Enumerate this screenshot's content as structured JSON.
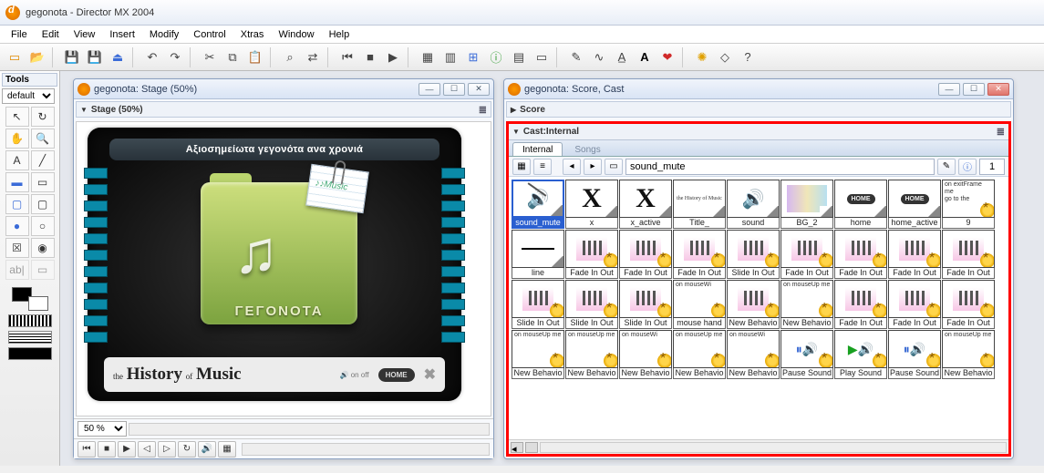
{
  "app": {
    "title": "gegonota - Director MX 2004"
  },
  "menu": [
    "File",
    "Edit",
    "View",
    "Insert",
    "Modify",
    "Control",
    "Xtras",
    "Window",
    "Help"
  ],
  "tools": {
    "header": "Tools",
    "mode": "default"
  },
  "stage": {
    "window_title": "gegonota: Stage (50%)",
    "panel_title": "Stage (50%)",
    "banner": "Αξιοσημείωτα γεγονότα ανα χρονιά",
    "folder_label": "ΓΕΓΟΝΟΤΑ",
    "note_label": "♪♪Music",
    "footer_the": "the",
    "footer_history": "History",
    "footer_of": "of",
    "footer_music": "Music",
    "footer_onoff": "on off",
    "footer_home": "HOME",
    "zoom": "50 %"
  },
  "scorecast": {
    "window_title": "gegonota: Score, Cast",
    "score_header": "Score",
    "cast_header": "Cast:Internal",
    "tabs": [
      "Internal",
      "Songs"
    ],
    "name_field": "sound_mute",
    "member_num": "1",
    "rows": [
      [
        {
          "label": "sound_mute",
          "kind": "sndoff",
          "sel": true,
          "corner": true
        },
        {
          "label": "x",
          "kind": "x",
          "corner": true
        },
        {
          "label": "x_active",
          "kind": "x",
          "corner": true
        },
        {
          "label": "Title_",
          "kind": "title",
          "corner": true
        },
        {
          "label": "sound",
          "kind": "snd",
          "corner": true
        },
        {
          "label": "BG_2",
          "kind": "grad",
          "corner": true
        },
        {
          "label": "home",
          "kind": "home",
          "corner": true
        },
        {
          "label": "home_active",
          "kind": "home",
          "corner": true
        },
        {
          "label": "9",
          "kind": "script",
          "gear": true,
          "txt": "on exitFrame me\n  go to the"
        }
      ],
      [
        {
          "label": "line",
          "kind": "line",
          "corner": true
        },
        {
          "label": "Fade In Out",
          "kind": "pink",
          "gear": true
        },
        {
          "label": "Fade In Out",
          "kind": "pink",
          "gear": true
        },
        {
          "label": "Fade In Out",
          "kind": "pink",
          "gear": true
        },
        {
          "label": "Slide In Out",
          "kind": "pink",
          "gear": true
        },
        {
          "label": "Fade In Out",
          "kind": "pink",
          "gear": true
        },
        {
          "label": "Fade In Out",
          "kind": "pink",
          "gear": true
        },
        {
          "label": "Fade In Out",
          "kind": "pink",
          "gear": true
        },
        {
          "label": "Fade In Out",
          "kind": "pink",
          "gear": true
        }
      ],
      [
        {
          "label": "Slide In Out",
          "kind": "pink",
          "gear": true
        },
        {
          "label": "Slide In Out",
          "kind": "pink",
          "gear": true
        },
        {
          "label": "Slide In Out",
          "kind": "pink",
          "gear": true
        },
        {
          "label": "mouse hand",
          "kind": "script",
          "gear": true,
          "txt": "on mouseWi"
        },
        {
          "label": "New Behavio",
          "kind": "pink",
          "gear": true
        },
        {
          "label": "New Behavio",
          "kind": "script",
          "gear": true,
          "txt": "on mouseUp me"
        },
        {
          "label": "Fade In Out",
          "kind": "pink",
          "gear": true
        },
        {
          "label": "Fade In Out",
          "kind": "pink",
          "gear": true
        },
        {
          "label": "Fade In Out",
          "kind": "pink",
          "gear": true
        }
      ],
      [
        {
          "label": "New Behavio",
          "kind": "script",
          "gear": true,
          "txt": "on mouseUp me"
        },
        {
          "label": "New Behavio",
          "kind": "script",
          "gear": true,
          "txt": "on mouseUp me"
        },
        {
          "label": "New Behavio",
          "kind": "script",
          "gear": true,
          "txt": "on mouseWi"
        },
        {
          "label": "New Behavio",
          "kind": "script",
          "gear": true,
          "txt": "on mouseUp me"
        },
        {
          "label": "New Behavio",
          "kind": "script",
          "gear": true,
          "txt": "on mouseWi"
        },
        {
          "label": "Pause Sound",
          "kind": "pause",
          "gear": true
        },
        {
          "label": "Play Sound",
          "kind": "play",
          "gear": true
        },
        {
          "label": "Pause Sound",
          "kind": "pause",
          "gear": true
        },
        {
          "label": "New Behavio",
          "kind": "script",
          "gear": true,
          "txt": "on mouseUp me"
        }
      ]
    ]
  }
}
